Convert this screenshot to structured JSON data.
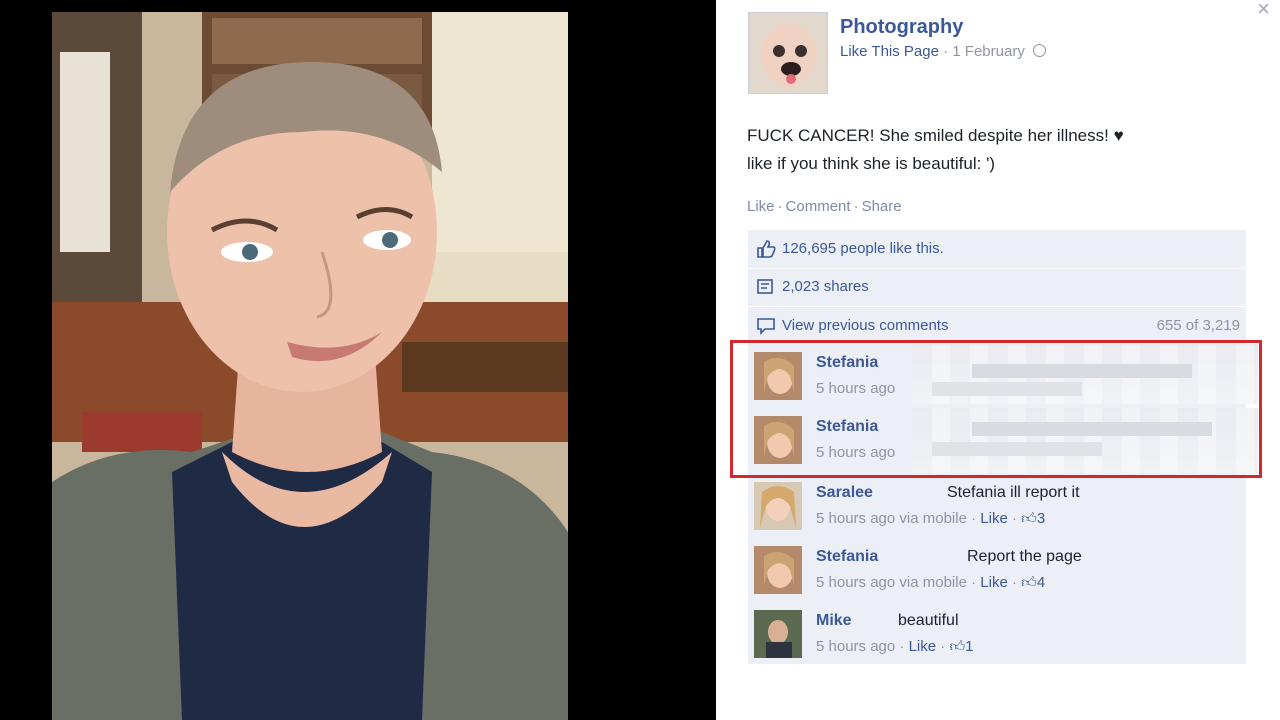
{
  "panel": {
    "close_glyph": "×",
    "page": {
      "name": "Photography",
      "like_link": "Like This Page",
      "dot": "·",
      "date": "1 February"
    },
    "post": {
      "line1": "FUCK CANCER! She smiled despite her illness! ♥",
      "line2": "like if you think she is beautiful: ')"
    },
    "actions": {
      "like": "Like",
      "comment": "Comment",
      "share": "Share"
    },
    "ufi": {
      "likes": "126,695 people like this.",
      "shares": "2,023 shares",
      "view_previous": "View previous comments",
      "count": "655 of 3,219"
    },
    "comments": [
      {
        "name": "Stefania",
        "text": "",
        "time": "5 hours ago",
        "via": "",
        "like": "",
        "likes": "",
        "censored": true
      },
      {
        "name": "Stefania",
        "text": "",
        "time": "5 hours ago",
        "via": "",
        "like": "",
        "likes": "",
        "censored": true
      },
      {
        "name": "Saralee",
        "text": "Stefania ill report it",
        "time": "5 hours ago via mobile",
        "like": "Like",
        "likes": "3",
        "censored": false
      },
      {
        "name": "Stefania",
        "text": "Report the page",
        "time": "5 hours ago via mobile",
        "like": "Like",
        "likes": "4",
        "censored": false
      },
      {
        "name": "Mike",
        "text": "beautiful",
        "time": "5 hours ago",
        "like": "Like",
        "likes": "1",
        "censored": false
      }
    ]
  },
  "icons": {
    "close": "close-icon",
    "globe": "globe-icon",
    "like": "thumbs-up-icon",
    "share": "share-icon",
    "comment": "comment-icon"
  },
  "colors": {
    "link": "#3b5998",
    "ufi_bg": "#eceff5",
    "highlight": "#d0282c"
  }
}
